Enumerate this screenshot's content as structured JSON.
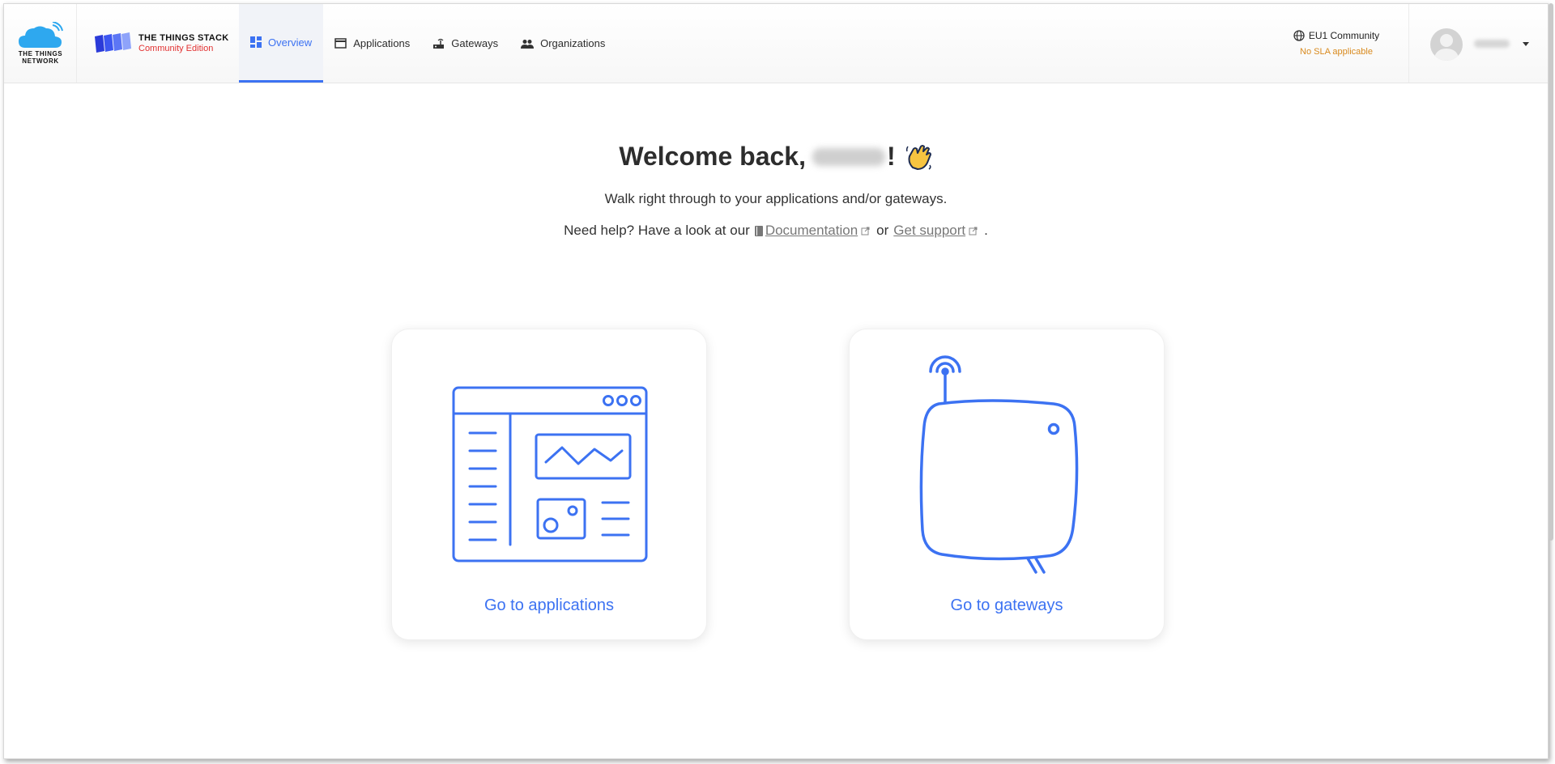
{
  "header": {
    "ttn_logo_text": "THE THINGS NETWORK",
    "stack_name": "THE THINGS STACK",
    "stack_edition": "Community Edition",
    "nav": [
      {
        "label": "Overview",
        "icon": "dashboard-icon",
        "active": true
      },
      {
        "label": "Applications",
        "icon": "application-window-icon",
        "active": false
      },
      {
        "label": "Gateways",
        "icon": "router-icon",
        "active": false
      },
      {
        "label": "Organizations",
        "icon": "people-icon",
        "active": false
      }
    ],
    "cluster": {
      "label": "EU1 Community",
      "icon": "globe-icon",
      "sla": "No SLA applicable"
    },
    "profile": {
      "icon": "avatar-icon",
      "dropdown_icon": "caret-down-icon"
    }
  },
  "main": {
    "title_prefix": "Welcome back,",
    "title_suffix": "!",
    "subtitle": "Walk right through to your applications and/or gateways.",
    "help_prefix": "Need help? Have a look at our",
    "documentation_link": "Documentation",
    "help_or": "or",
    "support_link": "Get support",
    "help_end": ".",
    "cards": [
      {
        "label": "Go to applications",
        "icon": "applications-illustration-icon"
      },
      {
        "label": "Go to gateways",
        "icon": "gateway-illustration-icon"
      }
    ]
  },
  "colors": {
    "accent": "#3c72f2",
    "sla": "#d98a1e",
    "edition": "#e23131"
  }
}
